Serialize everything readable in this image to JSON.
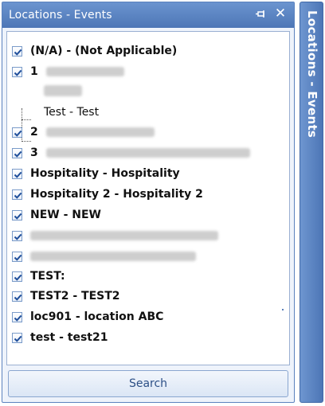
{
  "panel": {
    "title": "Locations - Events",
    "pin_icon": "pin-icon",
    "close_icon": "close-icon"
  },
  "list": {
    "items": [
      {
        "label": "(N/A) - (Not Applicable)",
        "checked": true
      },
      {
        "label": "1",
        "checked": true,
        "redacted": true
      },
      {
        "label": "",
        "checked": false,
        "redacted": true,
        "child": true
      },
      {
        "label": "Test - Test",
        "checked": false,
        "child": true
      },
      {
        "label": "2",
        "checked": true,
        "redacted": true
      },
      {
        "label": "3",
        "checked": true,
        "redacted": true
      },
      {
        "label": "Hospitality - Hospitality",
        "checked": true
      },
      {
        "label": "Hospitality 2 - Hospitality 2",
        "checked": true
      },
      {
        "label": "NEW - NEW",
        "checked": true
      },
      {
        "label": "",
        "checked": true,
        "redacted": true
      },
      {
        "label": "",
        "checked": true,
        "redacted": true
      },
      {
        "label": "TEST:",
        "checked": true
      },
      {
        "label": "TEST2 - TEST2",
        "checked": true
      },
      {
        "label": "loc901 - location ABC",
        "checked": true
      },
      {
        "label": "test - test21",
        "checked": true
      }
    ]
  },
  "search_button": {
    "label": "Search"
  },
  "side_tab": {
    "label": "Locations - Events"
  },
  "colors": {
    "title_bar": "#4d76b6",
    "panel_bg": "#eef3fb",
    "check_mark": "#1f4e9a"
  }
}
